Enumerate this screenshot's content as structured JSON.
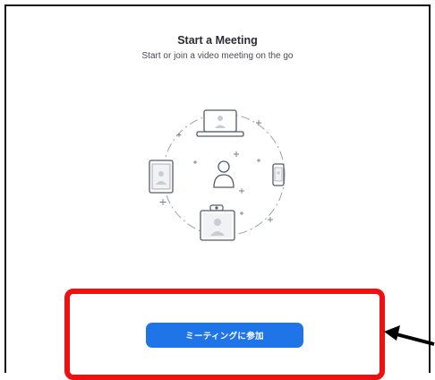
{
  "header": {
    "title": "Start a Meeting",
    "subtitle": "Start or join a video meeting on the go"
  },
  "illustration": {
    "icon": "devices-connected-illustration"
  },
  "actions": {
    "join_label": "ミーティングに参加"
  },
  "colors": {
    "button": "#1f74e8",
    "highlight": "#ee1111",
    "arrow": "#000000"
  }
}
